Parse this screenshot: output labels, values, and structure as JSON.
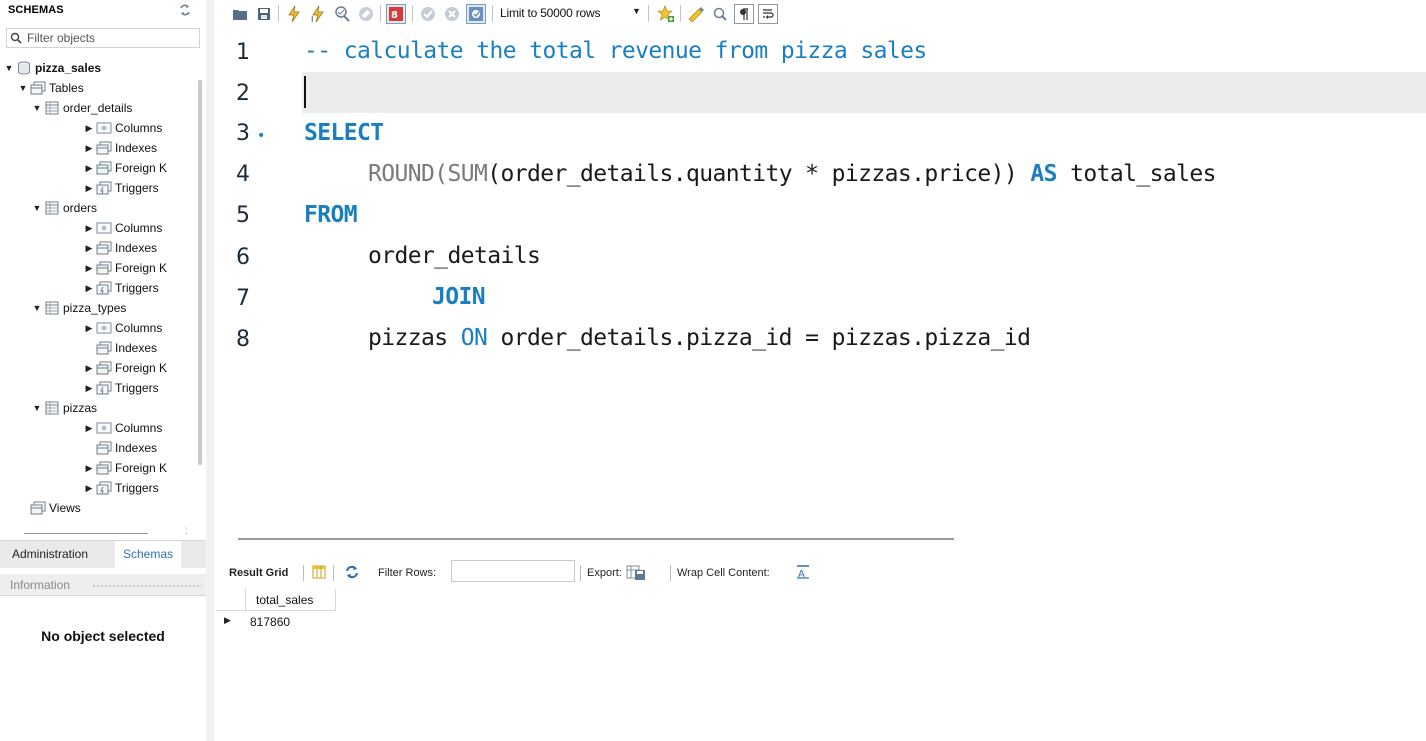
{
  "sidebar": {
    "title": "SCHEMAS",
    "filter_placeholder": "Filter objects",
    "schema_name": "pizza_sales",
    "tables_label": "Tables",
    "tables": [
      {
        "name": "order_details",
        "children": [
          "Columns",
          "Indexes",
          "Foreign K",
          "Triggers"
        ]
      },
      {
        "name": "orders",
        "children": [
          "Columns",
          "Indexes",
          "Foreign K",
          "Triggers"
        ]
      },
      {
        "name": "pizza_types",
        "children": [
          "Columns",
          "Indexes",
          "Foreign K",
          "Triggers"
        ]
      },
      {
        "name": "pizzas",
        "children": [
          "Columns",
          "Indexes",
          "Foreign K",
          "Triggers"
        ]
      }
    ],
    "views_label": "Views",
    "tabs": {
      "administration": "Administration",
      "schemas": "Schemas"
    },
    "info_title": "Information",
    "no_object": "No object selected"
  },
  "toolbar": {
    "limit_label": "Limit to 50000 rows",
    "icons": [
      "open-folder-icon",
      "save-icon",
      "execute-icon",
      "execute-current-icon",
      "explain-icon",
      "stop-icon",
      "toggle-continue-on-error-icon",
      "commit-icon",
      "rollback-icon",
      "autocommit-icon",
      "limit-rows-dropdown",
      "add-snippet-icon",
      "beautify-icon",
      "find-icon",
      "invisible-chars-icon",
      "wrap-lines-icon"
    ]
  },
  "editor": {
    "lines": [
      {
        "number": "1",
        "text": "-- calculate the total revenue from pizza sales"
      },
      {
        "number": "2",
        "text": ""
      },
      {
        "number": "3",
        "text": "SELECT"
      },
      {
        "number": "4",
        "text": "ROUND(SUM(order_details.quantity * pizzas.price)) AS total_sales"
      },
      {
        "number": "5",
        "text": "FROM"
      },
      {
        "number": "6",
        "text": "order_details"
      },
      {
        "number": "7",
        "text": "JOIN"
      },
      {
        "number": "8",
        "text": "pizzas ON order_details.pizza_id = pizzas.pizza_id"
      }
    ],
    "tokens": {
      "comment": "-- calculate the total revenue from pizza sales",
      "select": "SELECT",
      "round": "ROUND",
      "sum": "SUM",
      "expr": "(order_details.quantity * pizzas.price))",
      "as": "AS",
      "alias": "total_sales",
      "from": "FROM",
      "table1": "order_details",
      "join": "JOIN",
      "table2": "pizzas",
      "on": "ON",
      "condition": "order_details.pizza_id = pizzas.pizza_id",
      "open_paren": "(",
      "marker": "•"
    }
  },
  "results": {
    "result_grid_label": "Result Grid",
    "filter_rows_label": "Filter Rows:",
    "export_label": "Export:",
    "wrap_label": "Wrap Cell Content:",
    "columns": [
      "total_sales"
    ],
    "rows": [
      [
        "817860"
      ]
    ]
  },
  "colors": {
    "keyword": "#1a7fc0",
    "function": "#7a7a7a",
    "active_tab": "#2e6fb7"
  }
}
